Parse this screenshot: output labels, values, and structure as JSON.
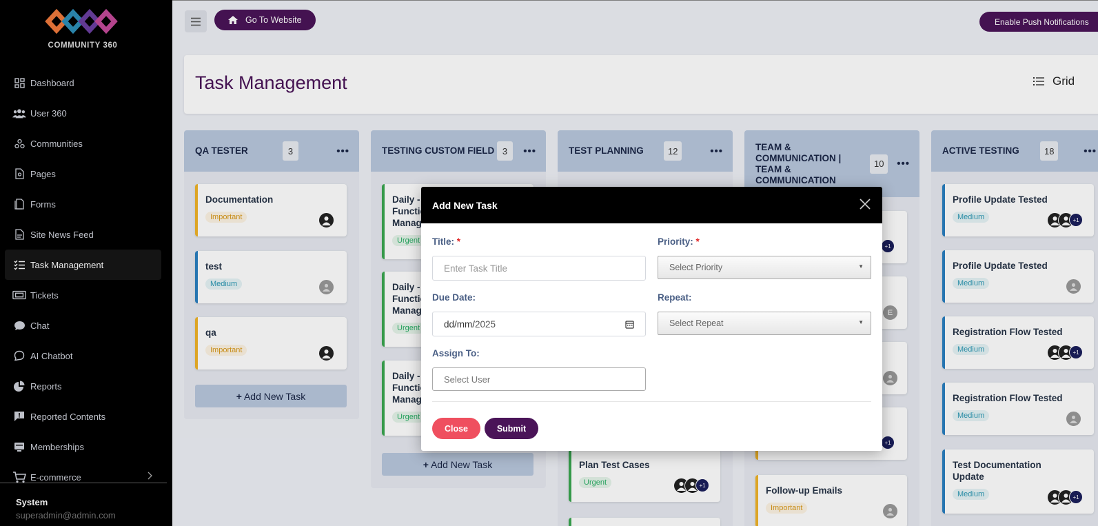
{
  "app": {
    "logo_text": "COMMUNITY 360"
  },
  "sidebar": {
    "items": [
      {
        "label": "Dashboard",
        "icon": "dashboard-icon"
      },
      {
        "label": "User 360",
        "icon": "users-icon"
      },
      {
        "label": "Communities",
        "icon": "communities-icon"
      },
      {
        "label": "Pages",
        "icon": "page-icon"
      },
      {
        "label": "Forms",
        "icon": "forms-icon"
      },
      {
        "label": "Site News Feed",
        "icon": "newsfeed-icon"
      },
      {
        "label": "Task Management",
        "icon": "tasks-icon",
        "active": true
      },
      {
        "label": "Tickets",
        "icon": "ticket-icon"
      },
      {
        "label": "Chat",
        "icon": "chat-icon"
      },
      {
        "label": "AI Chatbot",
        "icon": "chatbot-icon"
      },
      {
        "label": "Reports",
        "icon": "reports-icon"
      },
      {
        "label": "Reported Contents",
        "icon": "report-flag-icon"
      },
      {
        "label": "Memberships",
        "icon": "membership-icon"
      },
      {
        "label": "E-commerce",
        "icon": "cart-icon"
      }
    ],
    "user": {
      "name": "System",
      "email": "superadmin@admin.com"
    }
  },
  "topbar": {
    "go_website": "Go To Website",
    "push": "Enable Push Notifications"
  },
  "header": {
    "title": "Task Management",
    "view_toggle": "Grid"
  },
  "columns": [
    {
      "title": "QA TESTER",
      "count": "3",
      "cards": [
        {
          "title": "Documentation",
          "priority": "Important"
        },
        {
          "title": "test",
          "priority": "Medium"
        },
        {
          "title": "qa",
          "priority": "Important"
        }
      ]
    },
    {
      "title": "TESTING CUSTOM FIELD",
      "count": "3",
      "cards": [
        {
          "title": "Daily - Functio Manage",
          "priority": "Urgent"
        },
        {
          "title": "Daily - Functio Manage",
          "priority": "Urgent"
        },
        {
          "title": "Daily - Functio Manage",
          "priority": "Urgent"
        }
      ]
    },
    {
      "title": "TEST PLANNING",
      "count": "12",
      "cards": [
        {
          "title": "Plan Test Cases",
          "priority": "Urgent"
        }
      ]
    },
    {
      "title": "TEAM & COMMUNICATION | TEAM & COMMUNICATION",
      "count": "10",
      "cards": [
        {
          "title": "Follow-up Emails",
          "priority": "Important"
        }
      ]
    },
    {
      "title": "ACTIVE TESTING",
      "count": "18",
      "cards": [
        {
          "title": "Profile Update Tested",
          "priority": "Medium"
        },
        {
          "title": "Profile Update Tested",
          "priority": "Medium"
        },
        {
          "title": "Registration Flow Tested",
          "priority": "Medium"
        },
        {
          "title": "Registration Flow Tested",
          "priority": "Medium"
        },
        {
          "title": "Test Documentation Update",
          "priority": "Medium"
        }
      ]
    }
  ],
  "add_task": "Add New Task",
  "avatar_more": "+1",
  "avatar_initial": "E",
  "modal": {
    "title": "Add New Task",
    "title_label": "Title:",
    "title_placeholder": "Enter Task Title",
    "priority_label": "Priority:",
    "priority_value": "Select Priority",
    "due_label": "Due Date:",
    "due_value_dd": "dd/mm/",
    "due_value_yy": "2025",
    "repeat_label": "Repeat:",
    "repeat_value": "Select Repeat",
    "assign_label": "Assign To:",
    "assign_placeholder": "Select User",
    "required_mark": "*",
    "close": "Close",
    "submit": "Submit"
  },
  "colors": {
    "brand": "#4a1458",
    "danger": "#ef4f5f",
    "sidebar": "#000000"
  }
}
